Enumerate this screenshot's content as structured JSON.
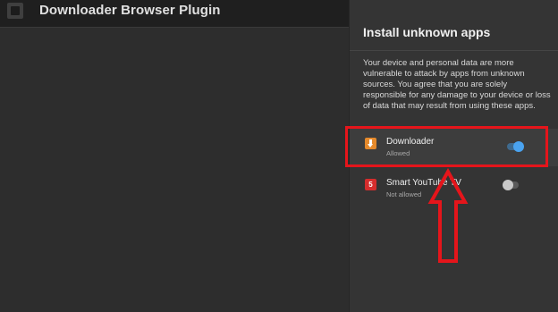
{
  "app": {
    "title": "Downloader Browser Plugin",
    "icon": "app-tile-icon"
  },
  "panel": {
    "title": "Install unknown apps",
    "warning": "Your device and personal data are more vulnerable to attack by apps from unknown sources. You agree that you are solely responsible for any damage to your device or loss of data that may result from using these apps."
  },
  "apps": [
    {
      "name": "Downloader",
      "status": "Allowed",
      "icon": "download-arrow-icon",
      "icon_color": "#e58a2c",
      "enabled": true
    },
    {
      "name": "Smart YouTube TV",
      "status": "Not allowed",
      "icon": "smart-youtube-tv-icon",
      "icon_glyph": "5",
      "icon_color": "#d62d2d",
      "enabled": false
    }
  ],
  "annotations": {
    "color": "#e5151b",
    "arrow": "up-arrow"
  }
}
